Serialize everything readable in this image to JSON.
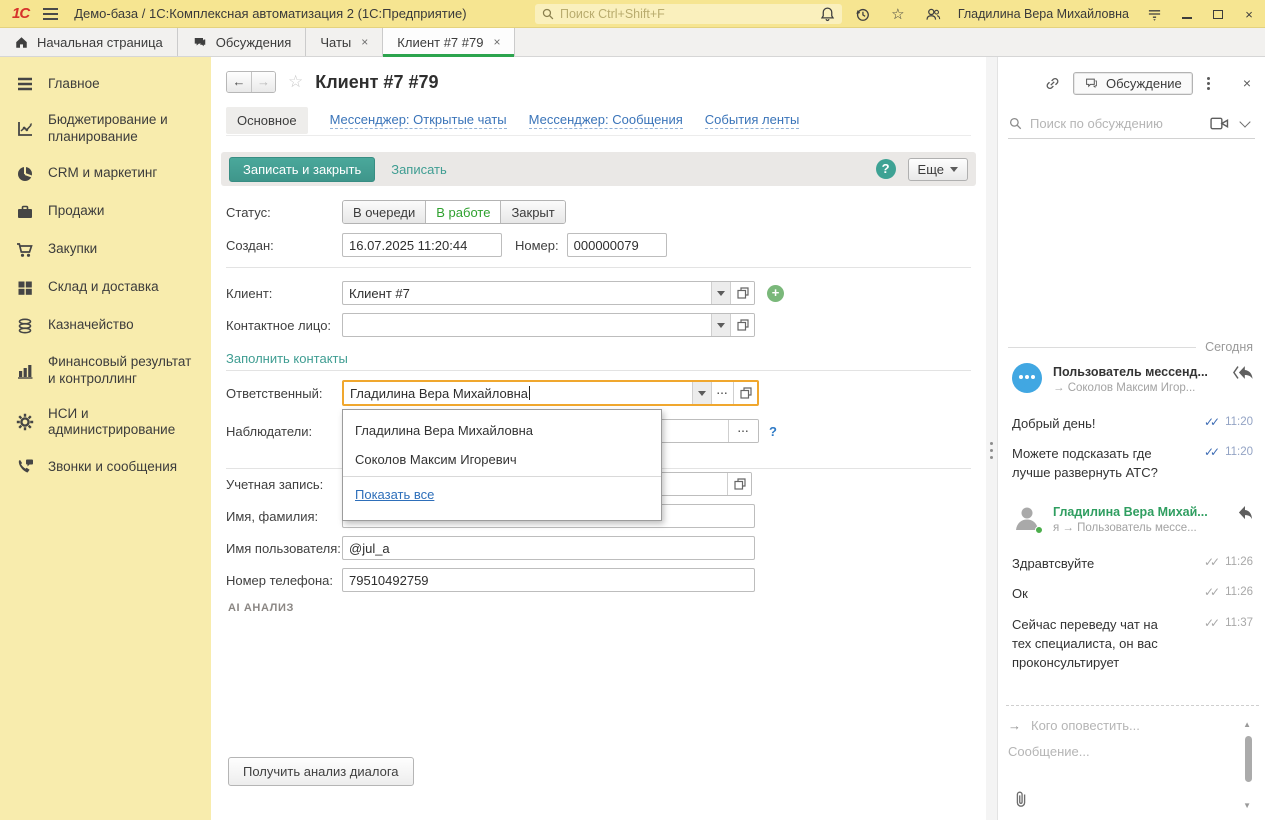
{
  "colors": {
    "brand_yellow": "#f6e591",
    "sidebar_yellow": "#f8ecad",
    "accent_teal": "#3f968b",
    "active_tab_green": "#2ca44e",
    "status_selected_green": "#2fa12f",
    "link_blue": "#3a74b9",
    "focus_border_orange": "#f0a72e",
    "logo_red": "#d6332b"
  },
  "titlebar": {
    "logo_text": "1С",
    "app_title": "Демо-база / 1С:Комплексная автоматизация 2  (1С:Предприятие)",
    "search_placeholder": "Поиск Ctrl+Shift+F",
    "user_name": "Гладилина Вера Михайловна"
  },
  "window_tabs": [
    {
      "label": "Начальная страница"
    },
    {
      "label": "Обсуждения"
    },
    {
      "label": "Чаты",
      "close": "×"
    },
    {
      "label": "Клиент #7 #79",
      "close": "×"
    }
  ],
  "sidebar": {
    "items": [
      {
        "label": "Главное"
      },
      {
        "label": "Бюджетирование и планирование"
      },
      {
        "label": "CRM и маркетинг"
      },
      {
        "label": "Продажи"
      },
      {
        "label": "Закупки"
      },
      {
        "label": "Склад и доставка"
      },
      {
        "label": "Казначейство"
      },
      {
        "label": "Финансовый результат и контроллинг"
      },
      {
        "label": "НСИ и администрирование"
      },
      {
        "label": "Звонки и сообщения"
      }
    ]
  },
  "form": {
    "title": "Клиент #7 #79",
    "nav_tabs": [
      "Основное",
      "Мессенджер: Открытые чаты",
      "Мессенджер: Сообщения",
      "События ленты"
    ],
    "toolbar": {
      "save_close": "Записать и закрыть",
      "save": "Записать",
      "help": "?",
      "more": "Еще"
    },
    "status": {
      "label": "Статус:",
      "options": [
        "В очереди",
        "В работе",
        "Закрыт"
      ],
      "selected": "В работе"
    },
    "created": {
      "label": "Создан:",
      "value": "16.07.2025 11:20:44"
    },
    "number": {
      "label": "Номер:",
      "value": "000000079"
    },
    "client": {
      "label": "Клиент:",
      "value": "Клиент #7"
    },
    "contact": {
      "label": "Контактное лицо:",
      "value": ""
    },
    "fill_contacts": "Заполнить контакты",
    "responsible": {
      "label": "Ответственный:",
      "value": "Гладилина Вера Михайловна"
    },
    "watchers": {
      "label": "Наблюдатели:",
      "value": "",
      "help": "?"
    },
    "account": {
      "label": "Учетная запись:",
      "value": ""
    },
    "fullname": {
      "label": "Имя, фамилия:",
      "value": ""
    },
    "username": {
      "label": "Имя пользователя:",
      "value": "@jul_a"
    },
    "phone": {
      "label": "Номер телефона:",
      "value": "79510492759"
    },
    "dropdown": {
      "items": [
        "Гладилина Вера Михайловна",
        "Соколов Максим Игоревич"
      ],
      "show_all": "Показать все"
    },
    "ai_section": "AI АНАЛИЗ",
    "analyze_button": "Получить анализ диалога"
  },
  "chat": {
    "panel_title": "Обсуждение",
    "search_placeholder": "Поиск по обсуждению",
    "date_divider": "Сегодня",
    "groups": [
      {
        "author": "Пользователь мессенд...",
        "direction": "→ Соколов Максим Игор...",
        "messages": [
          {
            "text": "Добрый день!",
            "time": "11:20"
          },
          {
            "text": "Можете подсказать где лучше развернуть АТС?",
            "time": "11:20"
          }
        ]
      },
      {
        "author": "Гладилина Вера Михай...",
        "direction": "я → Пользователь мессе...",
        "messages": [
          {
            "text": "Здравтсвуйте",
            "time": "11:26"
          },
          {
            "text": "Ок",
            "time": "11:26"
          },
          {
            "text": "Сейчас переведу чат на тех специалиста, он вас проконсультирует",
            "time": "11:37"
          }
        ]
      }
    ],
    "notify_placeholder": "Кого оповестить...",
    "message_placeholder": "Сообщение..."
  }
}
